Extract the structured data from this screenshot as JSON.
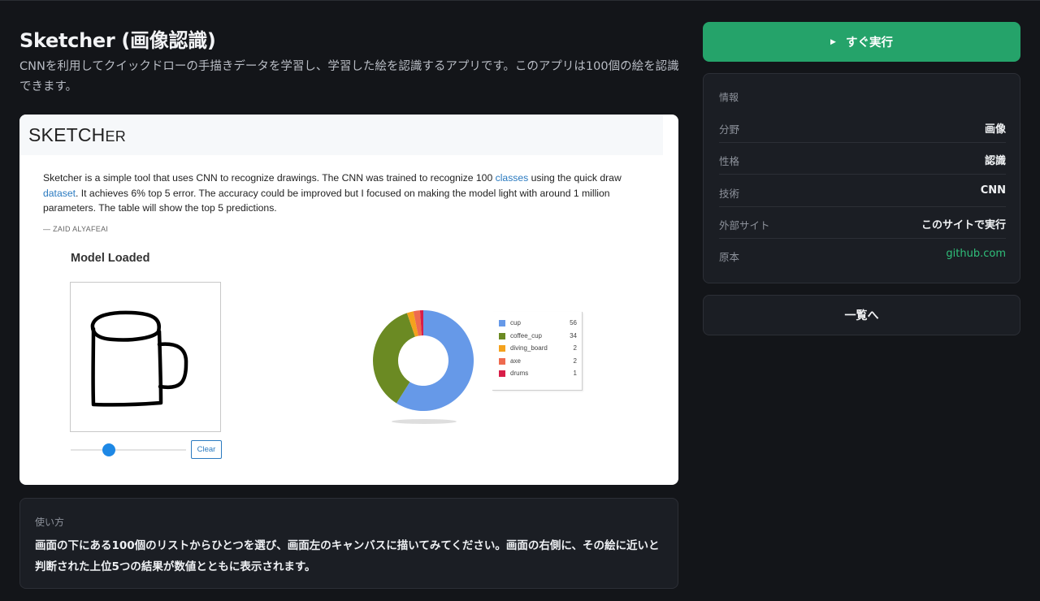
{
  "app": {
    "title": "Sketcher (画像認識)",
    "description": "CNNを利用してクイックドローの手描きデータを学習し、学習した絵を認識するアプリです。このアプリは100個の絵を認識できます。"
  },
  "preview": {
    "logo_main": "SKETCH",
    "logo_tail": "ER",
    "intro_1": "Sketcher is a simple tool that uses CNN to recognize drawings. The CNN was trained to recognize 100 ",
    "intro_link1": "classes",
    "intro_2": " using the quick draw ",
    "intro_link2": "dataset",
    "intro_3": ". It achieves 6% top 5 error. The accuracy could be improved but I focused on making the model light with around 1 million parameters. The table will show the top 5 predictions.",
    "author": "— ZAID ALYAFEAI",
    "status": "Model Loaded",
    "clear_label": "Clear",
    "brush_size_fraction": 0.33
  },
  "chart_data": {
    "type": "pie",
    "donut": true,
    "categories": [
      "cup",
      "coffee_cup",
      "diving_board",
      "axe",
      "drums"
    ],
    "values": [
      56,
      34,
      2,
      2,
      1
    ],
    "colors": [
      "#6699e8",
      "#6b8a23",
      "#f4a21d",
      "#ee6a4f",
      "#d81e48"
    ],
    "legend": "right"
  },
  "usage": {
    "label": "使い方",
    "text": "画面の下にある100個のリストからひとつを選び、画面左のキャンバスに描いてみてください。画面の右側に、その絵に近いと判断された上位5つの結果が数値とともに表示されます。"
  },
  "run_button": {
    "label": "すぐ実行",
    "icon": "play-icon"
  },
  "info": {
    "title": "情報",
    "rows": [
      {
        "key": "分野",
        "value": "画像"
      },
      {
        "key": "性格",
        "value": "認識"
      },
      {
        "key": "技術",
        "value": "CNN"
      },
      {
        "key": "外部サイト",
        "value": "このサイトで実行"
      },
      {
        "key": "原本",
        "value": "github.com"
      }
    ]
  },
  "list_button": {
    "label": "一覧へ"
  },
  "colors": {
    "background": "#131519",
    "card": "#1b1e24",
    "accent": "#25a36a",
    "link": "#2fbf7a"
  }
}
